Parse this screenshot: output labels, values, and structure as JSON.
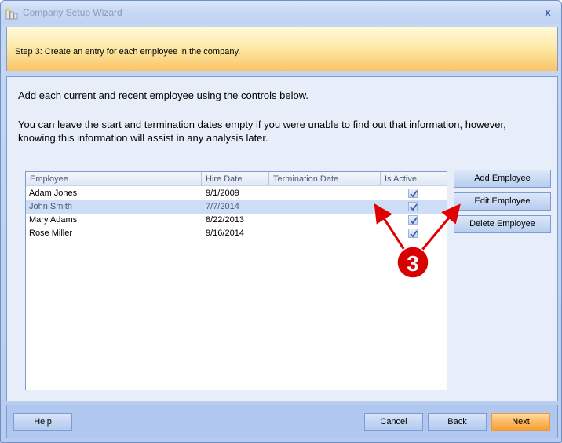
{
  "window": {
    "title": "Company Setup Wizard",
    "icon": "chart-bars-icon",
    "close_label": "x"
  },
  "banner": {
    "step_text": "Step 3: Create an entry for each employee in the company."
  },
  "content": {
    "intro_line1": "Add each current and recent employee using the controls below.",
    "intro_line2": "You can leave the start and termination dates empty if you were unable to find out that information, however, knowing this information will assist in any analysis later."
  },
  "employee_list": {
    "columns": [
      "Employee",
      "Hire Date",
      "Termination Date",
      "Is Active"
    ],
    "rows": [
      {
        "employee": "Adam Jones",
        "hire_date": "9/1/2009",
        "termination_date": "",
        "is_active": true,
        "selected": false
      },
      {
        "employee": "John Smith",
        "hire_date": "7/7/2014",
        "termination_date": "",
        "is_active": true,
        "selected": true
      },
      {
        "employee": "Mary Adams",
        "hire_date": "8/22/2013",
        "termination_date": "",
        "is_active": true,
        "selected": false
      },
      {
        "employee": "Rose Miller",
        "hire_date": "9/16/2014",
        "termination_date": "",
        "is_active": true,
        "selected": false
      }
    ]
  },
  "side_buttons": {
    "add": "Add Employee",
    "edit": "Edit Employee",
    "delete": "Delete Employee"
  },
  "footer": {
    "help": "Help",
    "cancel": "Cancel",
    "back": "Back",
    "next": "Next"
  },
  "annotation": {
    "label": "3",
    "color": "#e00000"
  }
}
